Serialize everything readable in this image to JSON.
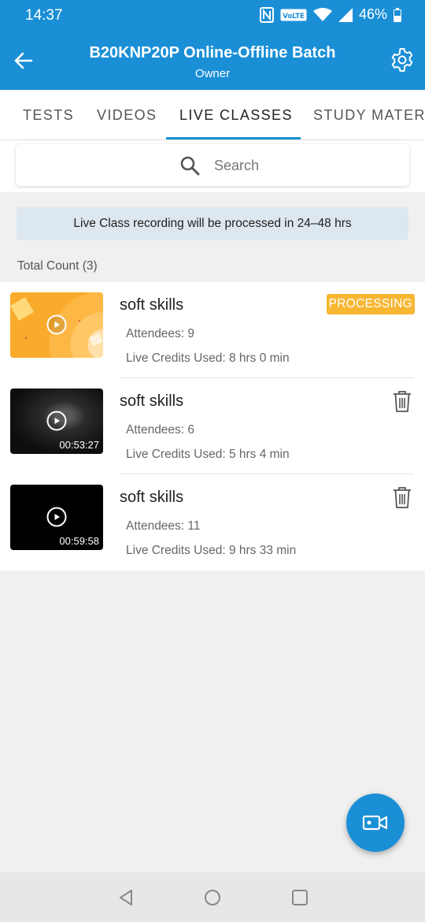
{
  "status_bar": {
    "time": "14:37",
    "volte_label": "VoLTE",
    "battery": "46%"
  },
  "app_bar": {
    "title": "B20KNP20P  Online-Offline Batch",
    "subtitle": "Owner"
  },
  "tabs": [
    {
      "label": "TESTS"
    },
    {
      "label": "VIDEOS"
    },
    {
      "label": "LIVE CLASSES",
      "active": true
    },
    {
      "label": "STUDY MATERIALS"
    }
  ],
  "search": {
    "placeholder": "Search"
  },
  "banner": "Live Class recording will be processed in 24–48 hrs",
  "total_count": "Total Count (3)",
  "recordings": [
    {
      "title": "soft skills",
      "attendees": "Attendees: 9",
      "credits": "Live Credits Used: 8 hrs 0 min",
      "status": "PROCESSING",
      "duration": ""
    },
    {
      "title": "soft skills",
      "attendees": "Attendees: 6",
      "credits": "Live Credits Used: 5 hrs 4 min",
      "status": "",
      "duration": "00:53:27"
    },
    {
      "title": "soft skills",
      "attendees": "Attendees: 11",
      "credits": "Live Credits Used: 9 hrs 33 min",
      "status": "",
      "duration": "00:59:58"
    }
  ],
  "colors": {
    "primary": "#1a8fd6",
    "badge": "#f7b733",
    "banner_bg": "#dde7ef"
  },
  "icons": {
    "back": "arrow-left-icon",
    "settings": "gear-icon",
    "search": "search-icon",
    "play": "play-icon",
    "delete": "trash-icon",
    "fab": "video-camera-icon"
  }
}
